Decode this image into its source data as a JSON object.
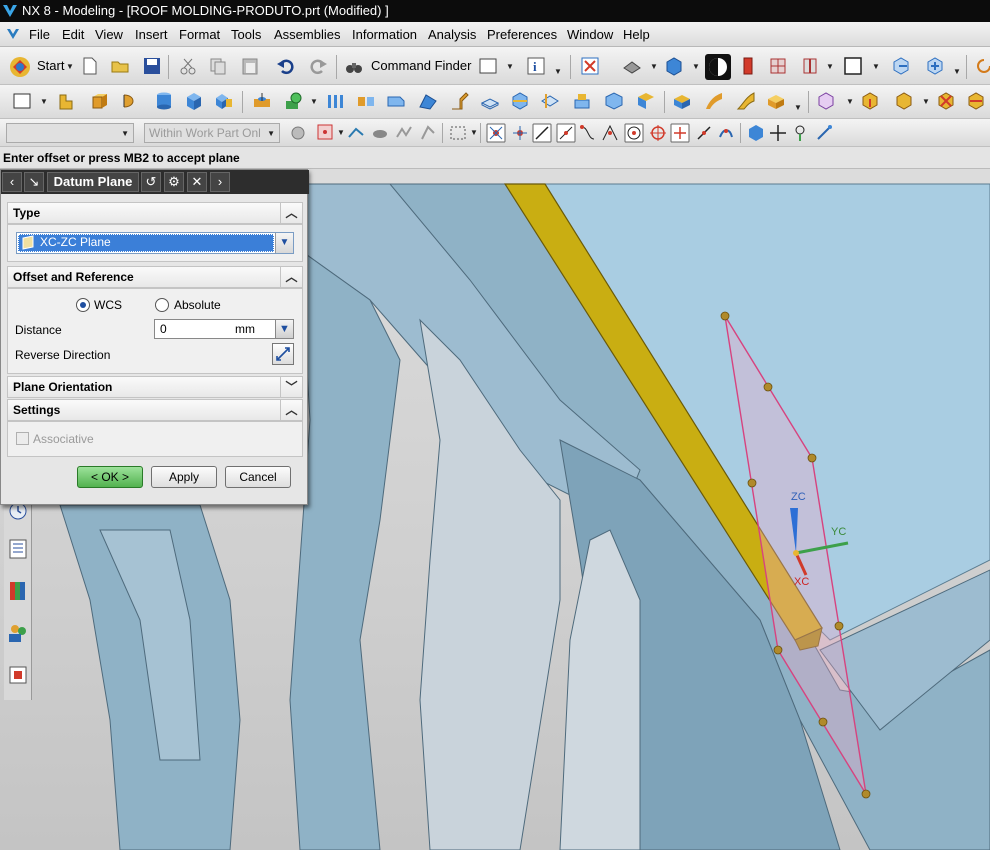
{
  "window": {
    "title": "NX 8 - Modeling - [ROOF MOLDING-PRODUTO.prt (Modified) ]"
  },
  "menus": [
    {
      "label": "File"
    },
    {
      "label": "Edit"
    },
    {
      "label": "View"
    },
    {
      "label": "Insert"
    },
    {
      "label": "Format"
    },
    {
      "label": "Tools"
    },
    {
      "label": "Assemblies"
    },
    {
      "label": "Information"
    },
    {
      "label": "Analysis"
    },
    {
      "label": "Preferences"
    },
    {
      "label": "Window"
    },
    {
      "label": "Help"
    }
  ],
  "toolbar": {
    "start_label": "Start",
    "command_finder_label": "Command Finder",
    "selection_filter_placeholder": "Within Work Part Onl"
  },
  "status": {
    "prompt": "Enter offset or press MB2 to accept plane"
  },
  "dialog": {
    "title": "Datum Plane",
    "type_section": {
      "label": "Type",
      "selected": "XC-ZC Plane"
    },
    "offset_section": {
      "label": "Offset and Reference",
      "wcs_label": "WCS",
      "absolute_label": "Absolute",
      "selected": "WCS",
      "distance_label": "Distance",
      "distance_value": "0",
      "distance_unit": "mm",
      "reverse_label": "Reverse Direction"
    },
    "orientation_section": {
      "label": "Plane Orientation"
    },
    "settings_section": {
      "label": "Settings",
      "associative_label": "Associative"
    },
    "ok_label": "< OK >",
    "apply_label": "Apply",
    "cancel_label": "Cancel"
  },
  "viewport": {
    "axis_labels": {
      "z": "ZC",
      "y": "YC",
      "x": "XC"
    }
  },
  "colors": {
    "plane_outline": "#d7437f",
    "molding": "#c9ae12",
    "body": "#8fb2c6",
    "active_item": "#3b7fd8"
  }
}
